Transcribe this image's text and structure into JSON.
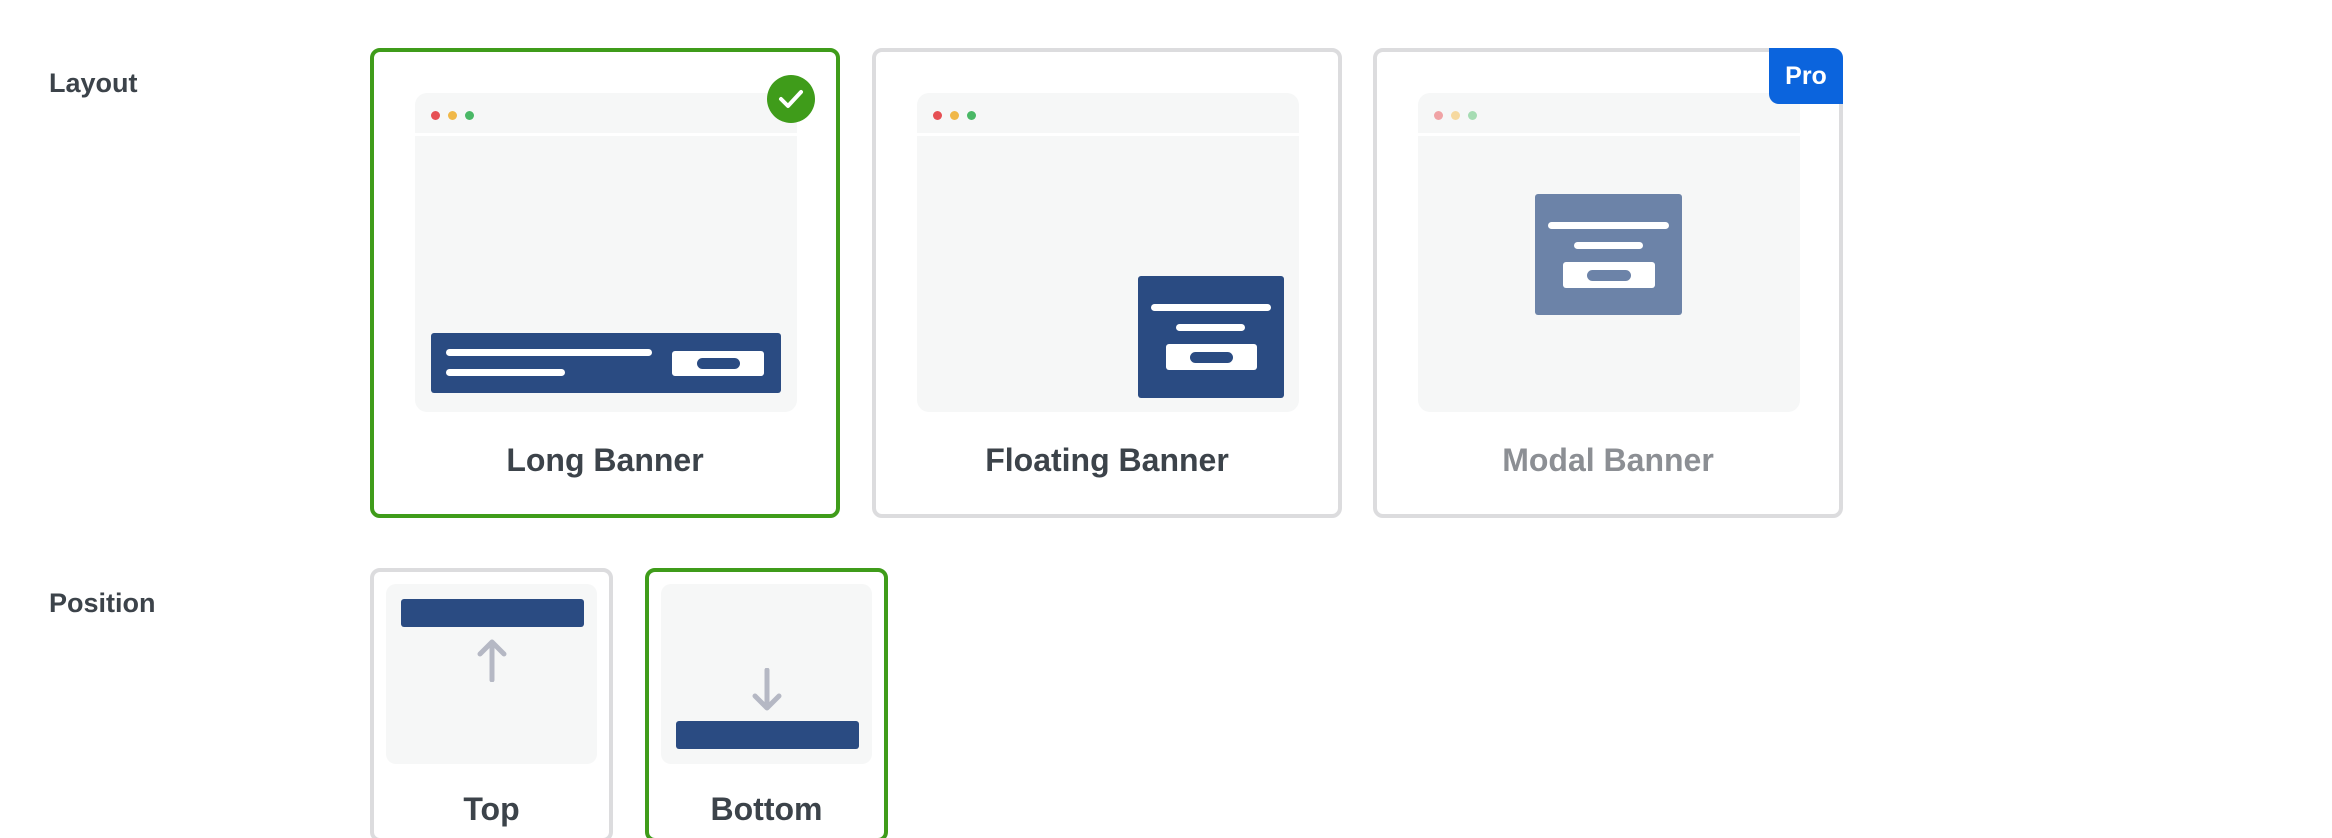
{
  "layout": {
    "label": "Layout",
    "options": [
      {
        "title": "Long Banner",
        "selected": true
      },
      {
        "title": "Floating Banner",
        "selected": false
      },
      {
        "title": "Modal Banner",
        "selected": false,
        "badge": "Pro"
      }
    ]
  },
  "position": {
    "label": "Position",
    "options": [
      {
        "title": "Top",
        "selected": false
      },
      {
        "title": "Bottom",
        "selected": true
      }
    ]
  },
  "colors": {
    "selected_border": "#3f9c1a",
    "banner": "#2a4b82",
    "pro_badge": "#0b64dd"
  },
  "icons": {
    "selected": "check-icon",
    "top": "arrow-up-icon",
    "bottom": "arrow-down-icon"
  }
}
